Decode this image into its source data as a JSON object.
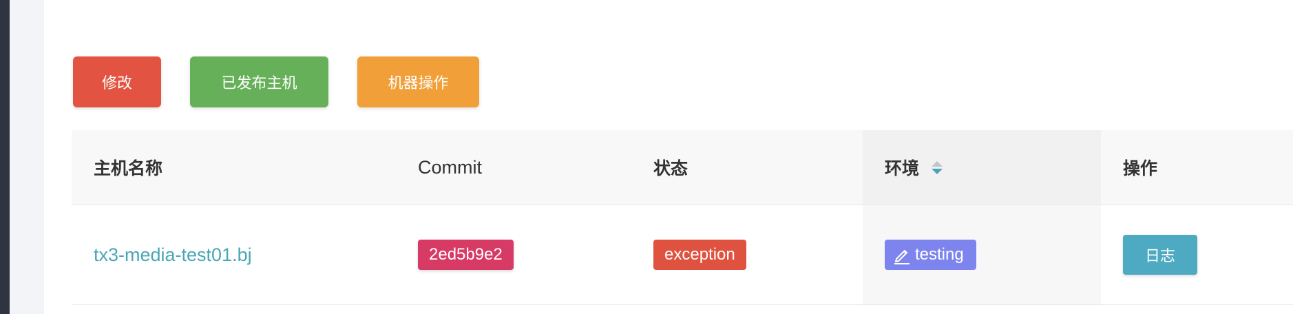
{
  "toolbar": {
    "edit_label": "修改",
    "published_hosts_label": "已发布主机",
    "machine_ops_label": "机器操作"
  },
  "colors": {
    "danger": "#e25441",
    "success": "#67b05a",
    "warning": "#f19f38",
    "link": "#49a6b5",
    "commit_tag": "#d83a66",
    "env_tag": "#7e84ee",
    "log_button": "#4eaac2"
  },
  "table": {
    "columns": [
      "主机名称",
      "Commit",
      "状态",
      "环境",
      "操作"
    ],
    "rows": [
      {
        "host_name": "tx3-media-test01.bj",
        "commit": "2ed5b9e2",
        "status": "exception",
        "environment": "testing",
        "environment_icon": "edit-pen-icon",
        "action_label": "日志"
      }
    ],
    "sort_icon": "sort-caret-icon"
  }
}
